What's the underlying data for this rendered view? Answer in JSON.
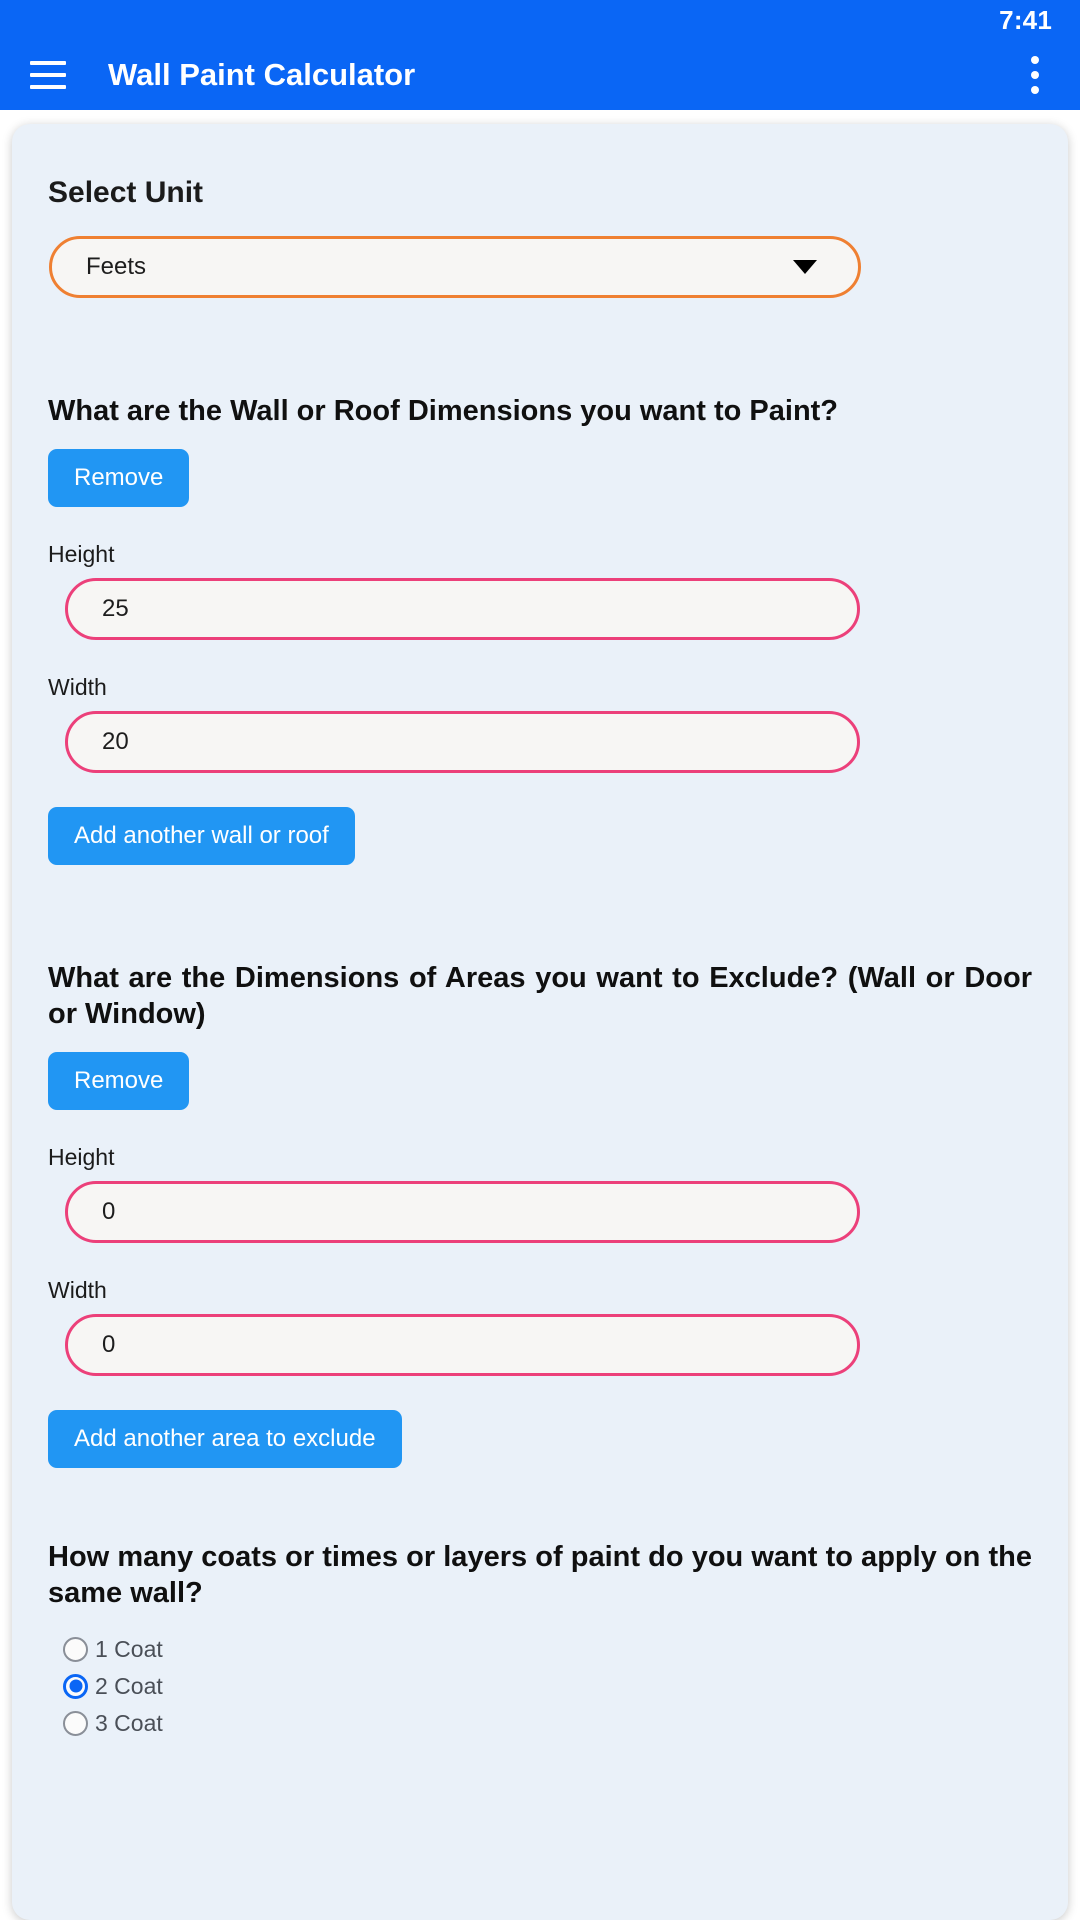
{
  "status_bar": {
    "time": "7:41"
  },
  "app_bar": {
    "title": "Wall Paint Calculator",
    "menu_icon": "hamburger-menu-icon",
    "overflow_icon": "more-vert-icon",
    "background_color": "#0a66f5"
  },
  "unit_section": {
    "label": "Select Unit",
    "selected_value": "Feets",
    "dropdown_icon": "chevron-down-icon",
    "border_color": "#ef8032"
  },
  "wall_section": {
    "question": "What are the Wall or Roof Dimensions you want to Paint?",
    "remove_label": "Remove",
    "height_label": "Height",
    "height_value": "25",
    "width_label": "Width",
    "width_value": "20",
    "add_label": "Add another wall or roof",
    "input_border_color": "#ec407a",
    "button_color": "#2196f3"
  },
  "exclude_section": {
    "question": "What are the Dimensions of Areas you want to Exclude? (Wall or Door or Window)",
    "remove_label": "Remove",
    "height_label": "Height",
    "height_value": "0",
    "width_label": "Width",
    "width_value": "0",
    "add_label": "Add another area to exclude"
  },
  "coats_section": {
    "question": "How many coats or times or layers of paint do you want to apply on the same wall?",
    "options": [
      {
        "label": "1 Coat",
        "selected": false
      },
      {
        "label": "2 Coat",
        "selected": true
      },
      {
        "label": "3 Coat",
        "selected": false
      }
    ],
    "selected_color": "#0a66f5"
  }
}
